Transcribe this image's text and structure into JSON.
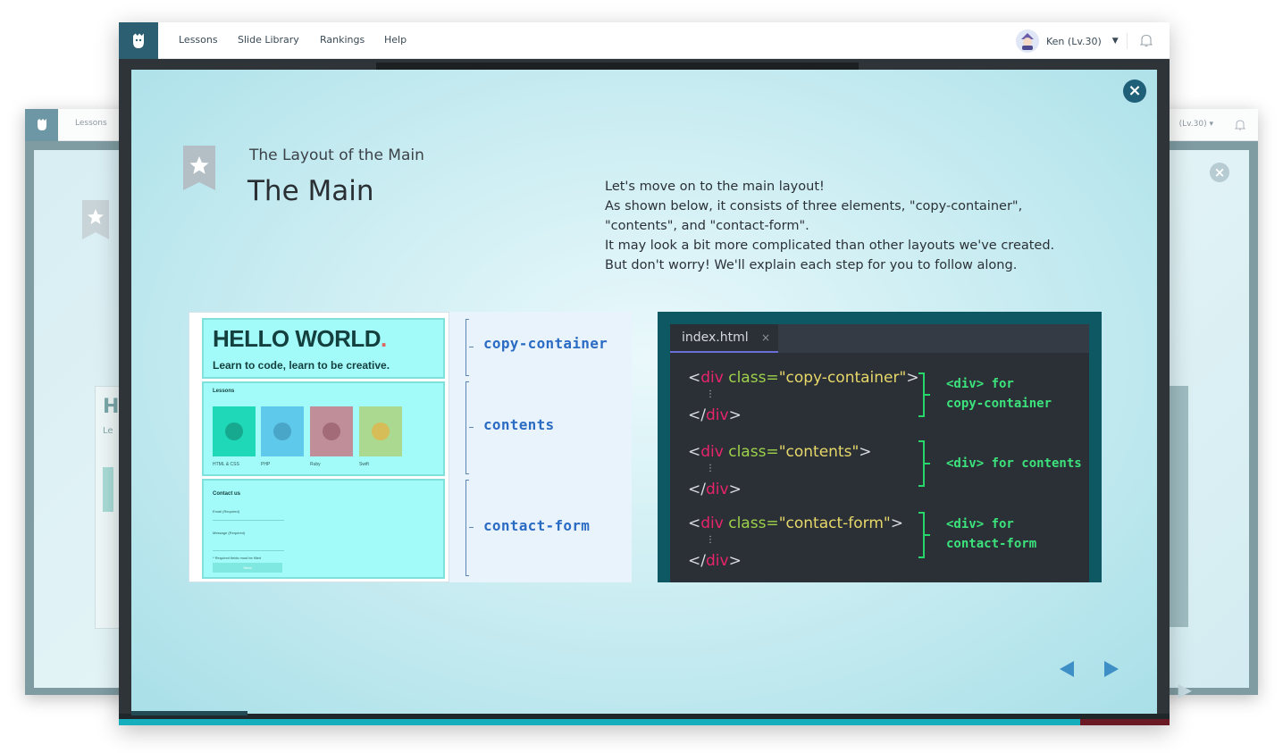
{
  "app": {
    "nav_links": [
      "Lessons",
      "Slide Library",
      "Rankings",
      "Help"
    ],
    "user_name": "Ken (Lv.30)",
    "back_window": {
      "nav_link": "Lessons",
      "user_name": "(Lv.30)"
    }
  },
  "slide": {
    "subtitle": "The Layout of the Main",
    "title": "The Main",
    "description": [
      "Let's move on to the main layout!",
      "As shown below, it consists of three elements, \"copy-container\",",
      "\"contents\", and \"contact-form\".",
      "It may look a bit more complicated than other layouts we've created.",
      "But don't worry! We'll explain each step for you to follow along."
    ],
    "illustration": {
      "hero_title": "HELLO WORLD",
      "hero_dot": ".",
      "hero_tagline": "Learn to code, learn to be creative.",
      "lessons_header": "Lessons",
      "lessons": [
        {
          "name": "HTML & CSS",
          "color": "#1ed8b8",
          "circle": "#17a98f"
        },
        {
          "name": "PHP",
          "color": "#5ec9ea",
          "circle": "#4aa6c9"
        },
        {
          "name": "Ruby",
          "color": "#c08e98",
          "circle": "#a36b78"
        },
        {
          "name": "Swift",
          "color": "#aad98f",
          "circle": "#d6bd57"
        }
      ],
      "contact_header": "Contact us",
      "form_labels": [
        "Email (Required)",
        "Message (Required)",
        "* Required fields must be filled"
      ],
      "send_label": "Send",
      "regions": [
        "copy-container",
        "contents",
        "contact-form"
      ]
    },
    "code": {
      "tab_name": "index.html",
      "tab_close": "×",
      "blocks": [
        {
          "class_value": "\"copy-container\"",
          "comment_lines": [
            "<div> for",
            "copy-container"
          ]
        },
        {
          "class_value": "\"contents\"",
          "comment_lines": [
            "<div> for contents"
          ]
        },
        {
          "class_value": "\"contact-form\"",
          "comment_lines": [
            "<div> for",
            "contact-form"
          ]
        }
      ],
      "open_prefix": "<",
      "tag": "div",
      "attr": " class=",
      "open_suffix": ">",
      "close_prefix": "</",
      "close_suffix": ">",
      "ellipsis": "⋮"
    },
    "close_icon": "×"
  },
  "colors": {
    "accent": "#2d5f73",
    "code_tag": "#e8246a",
    "code_attr": "#9ed24a",
    "code_string": "#e7d86a",
    "comment": "#3ce27c",
    "region_label": "#2a6bc4"
  },
  "icons": [
    "logo-icon",
    "close-icon",
    "star-bookmark-icon",
    "bell-icon",
    "caret-down-icon",
    "prev-arrow-icon",
    "next-arrow-icon"
  ]
}
